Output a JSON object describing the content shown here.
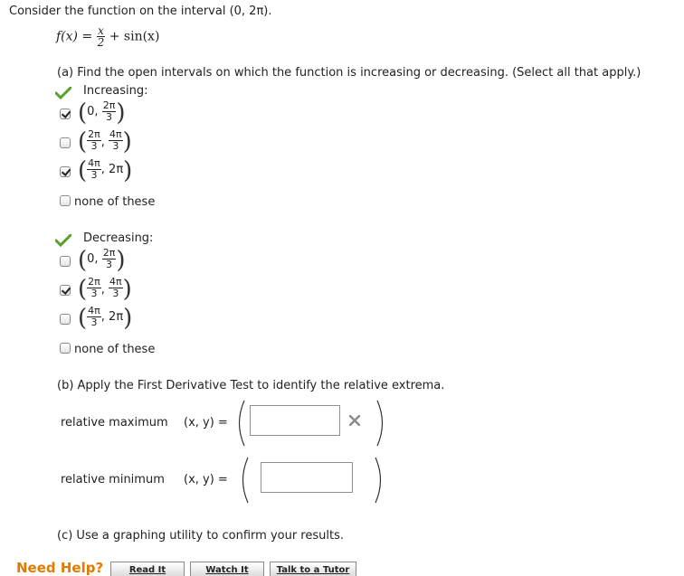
{
  "intro": "Consider the function on the interval (0, 2π).",
  "function": {
    "lhs": "f(x) =",
    "num": "x",
    "den": "2",
    "rhs": "+ sin(x)"
  },
  "part_a": {
    "prompt": "(a) Find the open intervals on which the function is increasing or decreasing. (Select all that apply.)",
    "increasing": {
      "label": "Increasing:",
      "options": [
        {
          "left": "0,",
          "num": "2π",
          "den": "3",
          "checked": true
        },
        {
          "num1": "2π",
          "den1": "3",
          "num2": "4π",
          "den2": "3",
          "checked": false
        },
        {
          "num": "4π",
          "den": "3",
          "right": "2π",
          "checked": true
        }
      ],
      "none": "none of these",
      "none_checked": false
    },
    "decreasing": {
      "label": "Decreasing:",
      "options": [
        {
          "left": "0,",
          "num": "2π",
          "den": "3",
          "checked": false
        },
        {
          "num1": "2π",
          "den1": "3",
          "num2": "4π",
          "den2": "3",
          "checked": true
        },
        {
          "num": "4π",
          "den": "3",
          "right": "2π",
          "checked": false
        }
      ],
      "none": "none of these",
      "none_checked": false
    }
  },
  "part_b": {
    "prompt": "(b) Apply the First Derivative Test to identify the relative extrema.",
    "max_label": "relative maximum",
    "min_label": "relative minimum",
    "xy": "(x, y) =",
    "max_value": "",
    "min_value": ""
  },
  "part_c": {
    "prompt": "(c) Use a graphing utility to confirm your results."
  },
  "help": {
    "label": "Need Help?",
    "buttons": [
      "Read It",
      "Watch It",
      "Talk to a Tutor"
    ]
  },
  "colors": {
    "check_green": "#5aa02c",
    "wrong_gray": "#8c8c8c",
    "help_orange": "#e07b00"
  }
}
